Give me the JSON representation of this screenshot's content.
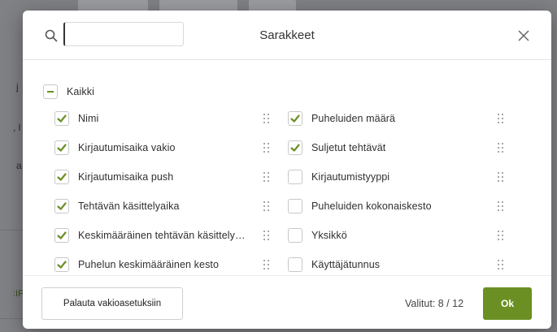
{
  "dialog": {
    "title": "Sarakkeet",
    "search": {
      "value": "",
      "placeholder": ""
    },
    "select_all": {
      "label": "Kaikki",
      "state": "indeterminate"
    },
    "columns_left": [
      {
        "label": "Nimi",
        "checked": true
      },
      {
        "label": "Kirjautumisaika vakio",
        "checked": true
      },
      {
        "label": "Kirjautumisaika push",
        "checked": true
      },
      {
        "label": "Tehtävän käsittelyaika",
        "checked": true
      },
      {
        "label": "Keskimääräinen tehtävän käsittely…",
        "checked": true
      },
      {
        "label": "Puhelun keskimääräinen kesto",
        "checked": true
      }
    ],
    "columns_right": [
      {
        "label": "Puheluiden määrä",
        "checked": true
      },
      {
        "label": "Suljetut tehtävät",
        "checked": true
      },
      {
        "label": "Kirjautumistyyppi",
        "checked": false
      },
      {
        "label": "Puheluiden kokonaiskesto",
        "checked": false
      },
      {
        "label": "Yksikkö",
        "checked": false
      },
      {
        "label": "Käyttäjätunnus",
        "checked": false
      }
    ],
    "footer": {
      "reset_label": "Palauta vakioasetuksiin",
      "selected_text": "Valitut: 8 / 12",
      "ok_label": "Ok"
    }
  },
  "background_fragments": [
    "j",
    ", l",
    "a",
    ":IF"
  ],
  "colors": {
    "accent": "#6b8f23",
    "check": "#6b8f23",
    "overlay": "#7f8184"
  }
}
